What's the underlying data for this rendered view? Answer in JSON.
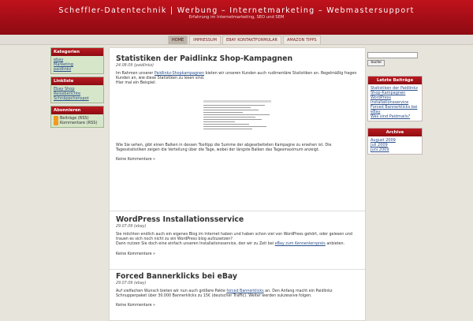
{
  "header": {
    "title": "Scheffler-Datentechnik | Werbung – Internetmarketing – Webmastersupport",
    "tagline": "Erfahrung im Internetmarketing, SEO und SEM"
  },
  "nav": [
    "HOME",
    "IMPRESSUM",
    "EBAY KONTAKTFORMULAR",
    "AMAZON TIPPS"
  ],
  "left_sidebar": {
    "kategorien": {
      "title": "Kategorien",
      "items": [
        "ebay",
        "Marketing",
        "paidlinkz"
      ]
    },
    "linkliste": {
      "title": "Linkliste",
      "items": [
        "Ebay Shop",
        "Reiseberichte",
        "Schnäppchenspot"
      ]
    },
    "abonnieren": {
      "title": "Abonnieren",
      "items": [
        "Beiträge (RSS)",
        "Kommentare (RSS)"
      ]
    }
  },
  "posts": [
    {
      "title": "Statistiken der Paidlinkz Shop-Kampagnen",
      "date": "24.08.09",
      "category": "paidlinkz",
      "p1_pre": "Im Rahmen unserer ",
      "p1_link": "Paidlinkz-Shopkampagnen",
      "p1_post": " bieten wir unseren Kunden auch rudimentäre Statistiken an. Regelmäßig fragen Kunden an, wie diese Statistiken zu lesen sind.",
      "p1_line2": "Hier mal ein Beispiel:",
      "p2": "Wie Sie sehen, gibt einen Balken in dessen Tooltipp die Summe der abgearbeiteten Kampagne zu ersehen ist. Die Tagesstatistiken zeigen die Verteilung über die Tage, wobei der längste Balken das Tagesmaximum anzeigt.",
      "more": "Keine Kommentare »"
    },
    {
      "title": "WordPress Installationsservice",
      "date": "29.07.09",
      "category": "ebay",
      "p1": "Sie möchten endlich auch ein eigenes Blog im Internet haben und haben schon viel von WordPress gehört, oder gelesen und trauen es sich noch nicht zu ein WordPress blog aufzusetzen?",
      "p2_pre": "Dann nutzen Sie doch eine einfach unseren Installationsservice, den wir zu Zeit bei ",
      "p2_link": "eBay zum Kennenlernpreis",
      "p2_post": " anbieten.",
      "more": "Keine Kommentare »"
    },
    {
      "title": "Forced Bannerklicks bei eBay",
      "date": "29.07.09",
      "category": "ebay",
      "p1_pre": "Auf vielfachen Wunsch bieten wir nun auch größere Pakte ",
      "p1_link": "forced Bannerklicks",
      "p1_post": " an. Den Anfang macht ein Paidlinkz Schnupperpaket über 30.000 Bannerklicks zu 15€ (deutscher Traffic). Weiter werden sukzessive folgen.",
      "more": "Keine Kommentare »"
    }
  ],
  "right_sidebar": {
    "search_button": "Suche",
    "letzte": {
      "title": "Letzte Beiträge",
      "items": [
        "Statistiken der Paidlinkz Shop-Kampagnen",
        "WordPress Installationsservice",
        "Forced Bannerklicks bei eBay",
        "Was sind Paidmails?"
      ]
    },
    "archive": {
      "title": "Archive",
      "items": [
        "August 2009",
        "Juli 2009",
        "Juni 2009"
      ]
    }
  }
}
